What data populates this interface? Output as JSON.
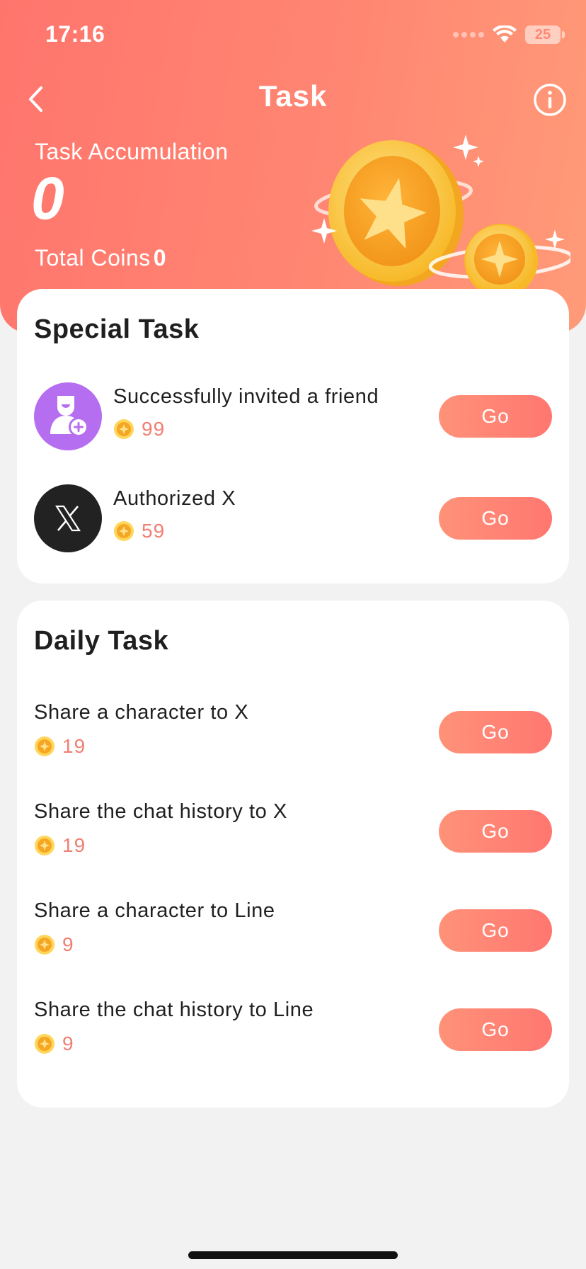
{
  "status_bar": {
    "time": "17:16",
    "battery": "25"
  },
  "header": {
    "title": "Task",
    "accumulation_label": "Task Accumulation",
    "accumulation_value": "0",
    "total_coins_label": "Total Coins",
    "total_coins_value": "0"
  },
  "special_task": {
    "title": "Special Task",
    "items": [
      {
        "label": "Successfully invited a friend",
        "reward": "99",
        "button": "Go",
        "icon": "invite-friend-icon",
        "icon_color": "#b66ef0"
      },
      {
        "label": "Authorized X",
        "reward": "59",
        "button": "Go",
        "icon": "x-logo-icon",
        "icon_color": "#222222"
      }
    ]
  },
  "daily_task": {
    "title": "Daily Task",
    "items": [
      {
        "label": "Share a character to X",
        "reward": "19",
        "button": "Go"
      },
      {
        "label": "Share the chat history to X",
        "reward": "19",
        "button": "Go"
      },
      {
        "label": "Share a character to Line",
        "reward": "9",
        "button": "Go"
      },
      {
        "label": "Share the chat history to Line",
        "reward": "9",
        "button": "Go"
      }
    ]
  },
  "colors": {
    "header_gradient_start": "#ff756d",
    "header_gradient_end": "#ff9b78",
    "reward_text": "#f07f72",
    "button_gradient_start": "#ff9279",
    "button_gradient_end": "#ff7770",
    "coin": "#f7c12e"
  }
}
